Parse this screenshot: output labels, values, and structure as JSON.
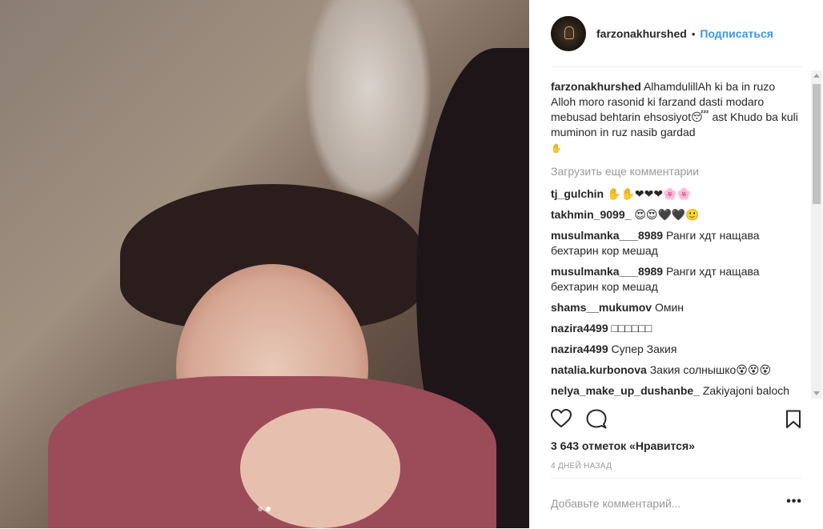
{
  "photo": {
    "carousel_total": 2,
    "carousel_active": 2
  },
  "header": {
    "username": "farzonakhurshed",
    "separator": "•",
    "follow_label": "Подписаться"
  },
  "caption": {
    "user": "farzonakhurshed",
    "text": "AlhamdulillAh ki ba in ruzo Alloh moro rasonid ki farzand dasti modaro mebusad behtarin ehsosiyot😴 ast Khudo ba kuli muminon in ruz nasib gardad",
    "trailing_icon": "✋"
  },
  "load_more_label": "Загрузить еще комментарии",
  "comments": [
    {
      "user": "tj_gulchin",
      "text": "✋✋❤❤❤🌸🌸"
    },
    {
      "user": "takhmin_9099_",
      "text": "😍😍🖤🖤🙂"
    },
    {
      "user": "musulmanka___8989",
      "text": "Ранги хдт нащава бехтарин кор мешад"
    },
    {
      "user": "musulmanka___8989",
      "text": "Ранги хдт нащава бехтарин кор мешад"
    },
    {
      "user": "shams__mukumov",
      "text": "Омин"
    },
    {
      "user": "nazira4499",
      "text": "□□□□□□"
    },
    {
      "user": "nazira4499",
      "text": "Супер Закия"
    },
    {
      "user": "natalia.kurbonova",
      "text": "Закия солнышко😵😵😵"
    },
    {
      "user": "nelya_make_up_dushanbe_",
      "text": "Zakiyajoni baloch mamurumbe asalakmda🖤💚💋"
    }
  ],
  "actions": {
    "like_icon": "heart-icon",
    "comment_icon": "comment-icon",
    "save_icon": "bookmark-icon"
  },
  "likes_label": "3 643 отметок «Нравится»",
  "time_label": "4 ДНЕЙ НАЗАД",
  "add_comment_placeholder": "Добавьте комментарий...",
  "options_label": "•••"
}
